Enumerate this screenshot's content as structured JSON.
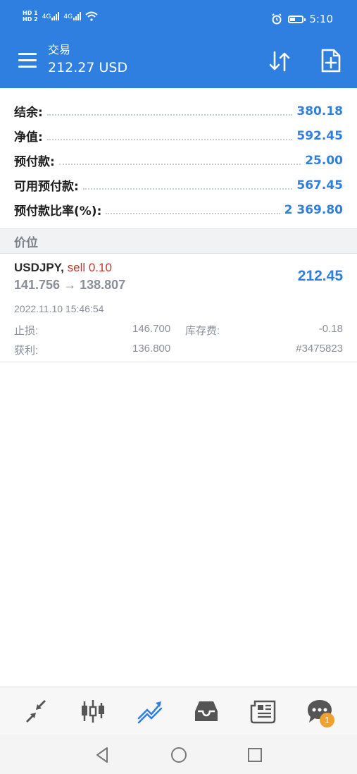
{
  "status_bar": {
    "hd_labels": [
      "HD 1",
      "HD 2"
    ],
    "network_labels": [
      "4G",
      "4G"
    ],
    "time": "5:10",
    "icons": [
      "signal-icon",
      "wifi-icon",
      "alarm-icon",
      "battery-icon"
    ]
  },
  "header": {
    "title": "交易",
    "subtitle": "212.27 USD",
    "icons": [
      "menu-icon",
      "sort-icon",
      "new-order-icon"
    ],
    "accent": "#2f7fe0"
  },
  "summary": {
    "rows": [
      {
        "label": "结余:",
        "value": "380.18"
      },
      {
        "label": "净值:",
        "value": "592.45"
      },
      {
        "label": "预付款:",
        "value": "25.00"
      },
      {
        "label": "可用预付款:",
        "value": "567.45"
      },
      {
        "label": "预付款比率(%):",
        "value": "2 369.80"
      }
    ]
  },
  "section": {
    "title": "价位"
  },
  "position": {
    "symbol": "USDJPY,",
    "side": "sell 0.10",
    "prices": "141.756 → 138.807",
    "profit": "212.45",
    "time": "2022.11.10 15:46:54",
    "sl_label": "止损:",
    "sl_value": "146.700",
    "swap_label": "库存费:",
    "swap_value": "-0.18",
    "tp_label": "获利:",
    "tp_value": "136.800",
    "ticket": "#3475823",
    "side_color": "#c0392b"
  },
  "bottom_nav": {
    "items": [
      "quotes-icon",
      "chart-icon",
      "trade-icon",
      "history-icon",
      "news-icon",
      "messages-icon"
    ],
    "active": "trade-icon",
    "messages_badge": "1"
  },
  "system_nav": {
    "items": [
      "back-icon",
      "home-icon",
      "recents-icon"
    ]
  }
}
